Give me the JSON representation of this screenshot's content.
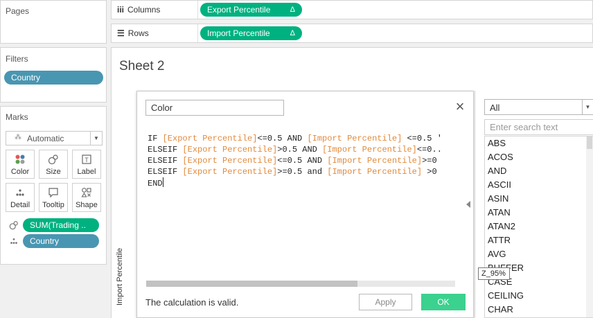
{
  "left_panel": {
    "pages_title": "Pages",
    "filters_title": "Filters",
    "filter_pill": "Country",
    "marks_title": "Marks",
    "marks_type": "Automatic",
    "mark_buttons": [
      {
        "label": "Color",
        "icon": "color-dots-icon"
      },
      {
        "label": "Size",
        "icon": "size-icon"
      },
      {
        "label": "Label",
        "icon": "label-icon"
      },
      {
        "label": "Detail",
        "icon": "detail-icon"
      },
      {
        "label": "Tooltip",
        "icon": "tooltip-icon"
      },
      {
        "label": "Shape",
        "icon": "shape-icon"
      }
    ],
    "mark_pills": [
      {
        "label": "SUM(Trading ..",
        "color": "#00b180",
        "icon": "size-icon"
      },
      {
        "label": "Country",
        "color": "#4996b2",
        "icon": "detail-icon"
      }
    ]
  },
  "shelves": {
    "columns_label": "Columns",
    "columns_pill": "Export Percentile",
    "rows_label": "Rows",
    "rows_pill": "Import Percentile",
    "delta": "Δ"
  },
  "sheet": {
    "title": "Sheet 2",
    "axis_label": "Import Percentile"
  },
  "calc_dialog": {
    "name": "Color",
    "code_lines": [
      [
        {
          "t": "IF "
        },
        {
          "t": "[Export Percentile]",
          "f": true
        },
        {
          "t": "<=0.5 AND "
        },
        {
          "t": "[Import Percentile]",
          "f": true
        },
        {
          "t": " <=0.5 '"
        }
      ],
      [
        {
          "t": "ELSEIF "
        },
        {
          "t": "[Export Percentile]",
          "f": true
        },
        {
          "t": ">0.5 AND "
        },
        {
          "t": "[Import Percentile]",
          "f": true
        },
        {
          "t": "<=0.."
        }
      ],
      [
        {
          "t": "ELSEIF "
        },
        {
          "t": "[Export Percentile]",
          "f": true
        },
        {
          "t": "<=0.5 AND "
        },
        {
          "t": "[Import Percentile]",
          "f": true
        },
        {
          "t": ">=0"
        }
      ],
      [
        {
          "t": "ELSEIF "
        },
        {
          "t": "[Export Percentile]",
          "f": true
        },
        {
          "t": ">=0.5 and "
        },
        {
          "t": "[Import Percentile]",
          "f": true
        },
        {
          "t": " >0"
        }
      ],
      [
        {
          "t": "END"
        }
      ]
    ],
    "status": "The calculation is valid.",
    "apply_label": "Apply",
    "ok_label": "OK"
  },
  "functions": {
    "category": "All",
    "search_placeholder": "Enter search text",
    "items": [
      "ABS",
      "ACOS",
      "AND",
      "ASCII",
      "ASIN",
      "ATAN",
      "ATAN2",
      "ATTR",
      "AVG",
      "BUFFER",
      "CASE",
      "CEILING",
      "CHAR"
    ]
  },
  "tooltip": "Z_95%",
  "colors": {
    "green_pill": "#00b180",
    "blue_pill": "#4996b2",
    "ok_button": "#3bd18f",
    "field_ref": "#e28a3c"
  }
}
